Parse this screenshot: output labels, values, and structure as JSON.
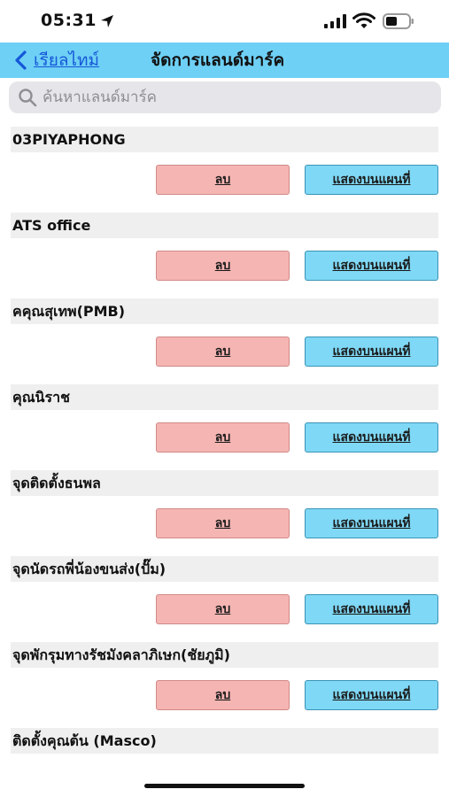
{
  "status_bar": {
    "time": "05:31"
  },
  "nav": {
    "back_label": "เรียลไทม์",
    "title": "จัดการแลนด์มาร์ค"
  },
  "search": {
    "placeholder": "ค้นหาแลนด์มาร์ค",
    "value": ""
  },
  "buttons": {
    "delete_label": "ลบ",
    "show_label": "แสดงบนแผนที่"
  },
  "landmarks": [
    {
      "name": "03PIYAPHONG"
    },
    {
      "name": "ATS office"
    },
    {
      "name": "คคุณสุเทพ(PMB)"
    },
    {
      "name": "คุณนิราช"
    },
    {
      "name": "จุดติดตั้งธนพล"
    },
    {
      "name": "จุดนัดรถพี่น้องขนส่ง(ปั๊ม)"
    },
    {
      "name": "จุดพักรุมทางรัชมังคลาภิเษก(ชัยภูมิ)"
    },
    {
      "name": "ติดตั้งคุณต้น (Masco)"
    }
  ],
  "colors": {
    "nav_background": "#6ed0f5",
    "back_link": "#1557d8",
    "delete_button": "#f5b5b3",
    "show_button": "#7fd8f5"
  },
  "icons": [
    "location-arrow-icon",
    "cellular-signal-icon",
    "wifi-icon",
    "battery-icon",
    "chevron-left-icon",
    "search-icon"
  ]
}
